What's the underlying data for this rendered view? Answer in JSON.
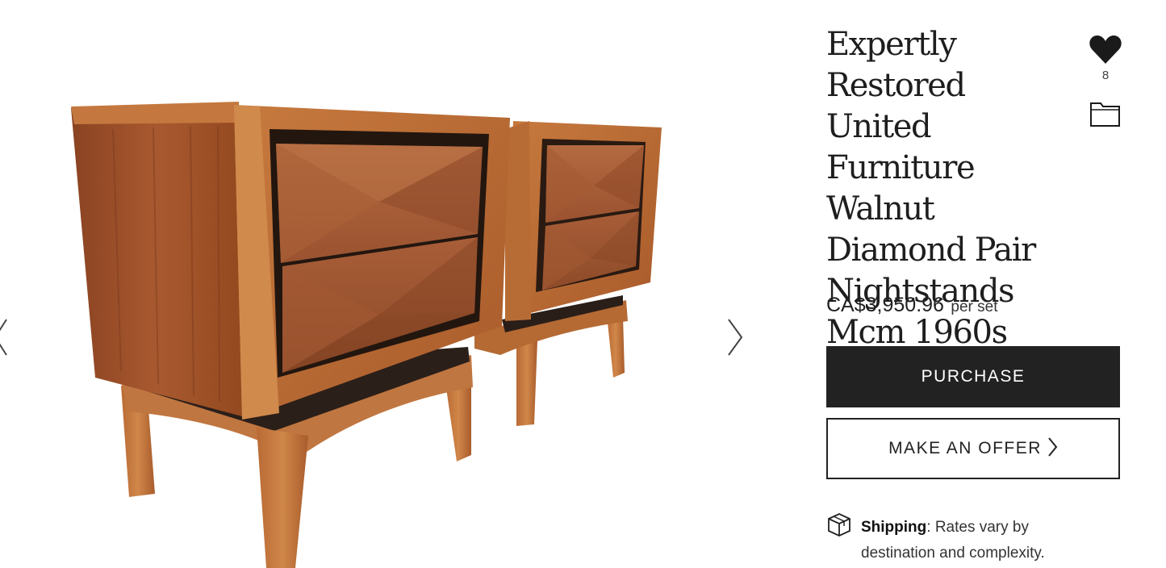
{
  "product": {
    "title": "Expertly Restored United Furniture Walnut Diamond Pair Nightstands Mcm 1960s",
    "price": "CA$3,950.96",
    "price_unit": "per set",
    "favorites_count": "8"
  },
  "actions": {
    "purchase_label": "PURCHASE",
    "offer_label": "MAKE AN OFFER"
  },
  "shipping": {
    "label": "Shipping",
    "separator": ":",
    "text": " Rates vary by destination and complexity."
  },
  "icons": {
    "favorite": "heart-icon",
    "save": "folder-icon",
    "shipping": "box-icon",
    "prev": "chevron-left-icon",
    "next": "chevron-right-icon"
  },
  "colors": {
    "button_dark": "#222222",
    "wood": "#a65a30",
    "background": "#ffffff"
  }
}
